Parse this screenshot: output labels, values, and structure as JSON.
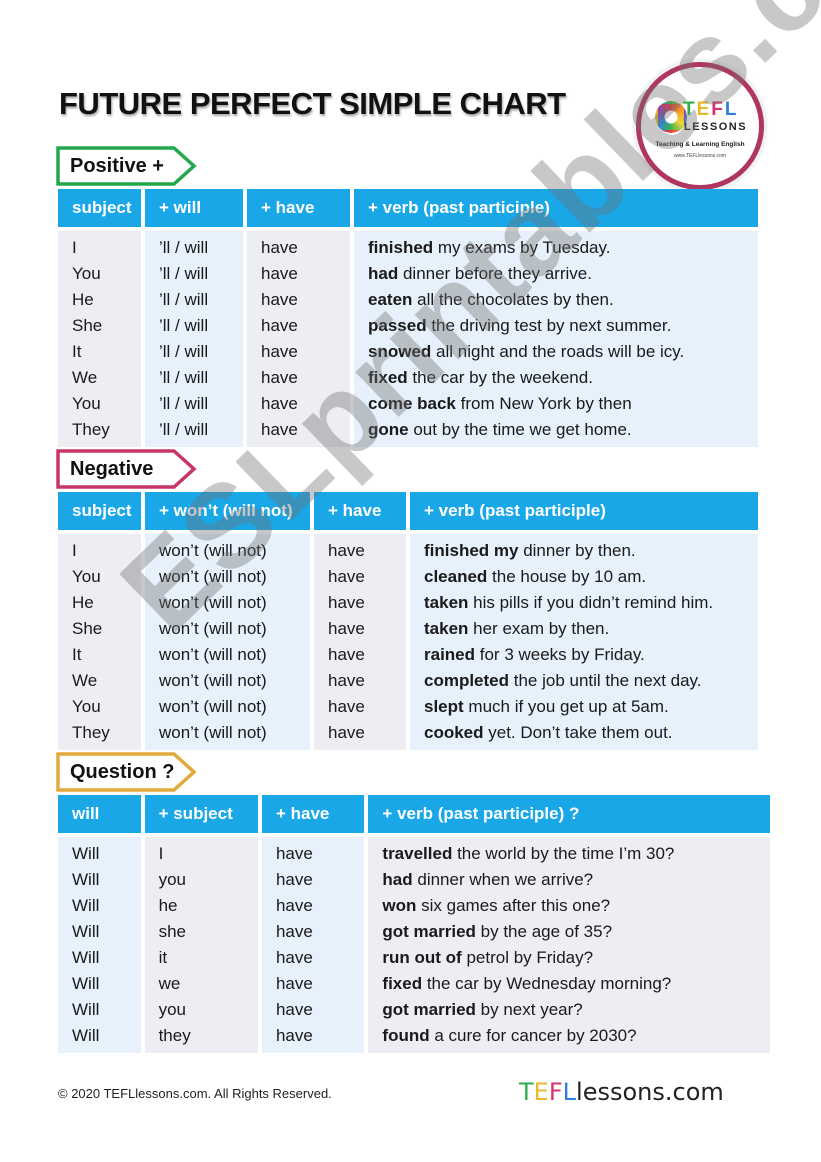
{
  "title": "FUTURE PERFECT SIMPLE CHART",
  "logo": {
    "letters": [
      "T",
      "E",
      "F",
      "L"
    ],
    "subtitle": "LESSONS",
    "tagline": "Teaching & Learning English",
    "url": "www.TEFLlessons.com"
  },
  "colors": {
    "header_blue": "#1aa7e8",
    "positive_tag": "#22a84a",
    "negative_tag": "#c7356b",
    "question_tag": "#e2a93b",
    "logo_ring": "#b0365f"
  },
  "sections": [
    {
      "tag": "Positive +",
      "headers": [
        "subject",
        "+ will",
        "+ have",
        "+ verb (past participle)"
      ],
      "rows": [
        {
          "c1": "I",
          "c2": "’ll / will",
          "c3": "have",
          "bold": "finished",
          "rest": " my exams by Tuesday."
        },
        {
          "c1": "You",
          "c2": "’ll / will",
          "c3": "have",
          "bold": "had",
          "rest": " dinner before they arrive."
        },
        {
          "c1": "He",
          "c2": "’ll / will",
          "c3": "have",
          "bold": "eaten",
          "rest": " all the chocolates by then."
        },
        {
          "c1": "She",
          "c2": "’ll / will",
          "c3": "have",
          "bold": "passed",
          "rest": " the driving test by next summer."
        },
        {
          "c1": "It",
          "c2": "’ll / will",
          "c3": "have",
          "bold": "snowed",
          "rest": " all night and the roads will be icy."
        },
        {
          "c1": "We",
          "c2": "’ll / will",
          "c3": "have",
          "bold": "fixed",
          "rest": " the car by the weekend."
        },
        {
          "c1": "You",
          "c2": "’ll / will",
          "c3": "have",
          "bold": "come back",
          "rest": " from New York by then"
        },
        {
          "c1": "They",
          "c2": "’ll / will",
          "c3": "have",
          "bold": "gone",
          "rest": " out by the time we get home."
        }
      ]
    },
    {
      "tag": "Negative",
      "headers": [
        "subject",
        "+ won’t (will not)",
        "+ have",
        "+ verb (past participle)"
      ],
      "rows": [
        {
          "c1": "I",
          "c2": "won’t (will not)",
          "c3": "have",
          "bold": "finished my",
          "rest": " dinner by then."
        },
        {
          "c1": "You",
          "c2": "won’t (will not)",
          "c3": "have",
          "bold": "cleaned",
          "rest": " the house by 10 am."
        },
        {
          "c1": "He",
          "c2": "won’t (will not)",
          "c3": "have",
          "bold": "taken",
          "rest": " his pills if you didn’t remind him."
        },
        {
          "c1": "She",
          "c2": "won’t (will not)",
          "c3": "have",
          "bold": "taken",
          "rest": " her exam by then."
        },
        {
          "c1": "It",
          "c2": "won’t (will not)",
          "c3": "have",
          "bold": "rained",
          "rest": " for 3 weeks by Friday."
        },
        {
          "c1": "We",
          "c2": "won’t (will not)",
          "c3": "have",
          "bold": "completed",
          "rest": " the job until the next day."
        },
        {
          "c1": "You",
          "c2": "won’t (will not)",
          "c3": "have",
          "bold": "slept",
          "rest": " much if you get up at 5am."
        },
        {
          "c1": "They",
          "c2": "won’t (will not)",
          "c3": "have",
          "bold": "cooked",
          "rest": " yet. Don’t take them out."
        }
      ]
    },
    {
      "tag": "Question ?",
      "headers": [
        "will",
        "+  subject",
        "+ have",
        "+ verb (past participle) ?"
      ],
      "rows": [
        {
          "c1": "Will",
          "c2": "I",
          "c3": "have",
          "bold": "travelled",
          "rest": " the world by the time I’m 30?"
        },
        {
          "c1": "Will",
          "c2": "you",
          "c3": "have",
          "bold": "had",
          "rest": " dinner when we arrive?"
        },
        {
          "c1": "Will",
          "c2": "he",
          "c3": "have",
          "bold": "won",
          "rest": " six games after this one?"
        },
        {
          "c1": "Will",
          "c2": "she",
          "c3": "have",
          "bold": "got married",
          "rest": " by the age of 35?"
        },
        {
          "c1": "Will",
          "c2": "it",
          "c3": "have",
          "bold": "run out of",
          "rest": " petrol by Friday?"
        },
        {
          "c1": "Will",
          "c2": "we",
          "c3": "have",
          "bold": "fixed",
          "rest": " the car by Wednesday morning?"
        },
        {
          "c1": "Will",
          "c2": "you",
          "c3": "have",
          "bold": "got married",
          "rest": " by next year?"
        },
        {
          "c1": "Will",
          "c2": "they",
          "c3": "have",
          "bold": "found",
          "rest": " a cure for cancer by 2030?"
        }
      ]
    }
  ],
  "watermark": "ESLprintables.com",
  "footer": {
    "copyright": "© 2020 TEFLlessons.com. All Rights Reserved.",
    "brand_letters": [
      "T",
      "E",
      "F",
      "L"
    ],
    "brand_rest": "lessons.com"
  }
}
